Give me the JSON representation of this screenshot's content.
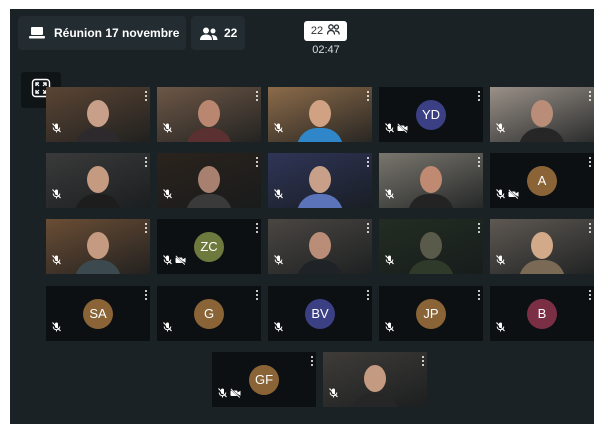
{
  "meeting": {
    "title": "Réunion 17 novembre",
    "participant_count": "22",
    "center_count": "22",
    "timer": "02:47"
  },
  "icons": {
    "title_icon": "laptop-icon",
    "participants_icon": "people-icon",
    "center_icon": "people-outline-icon",
    "expand_icon": "fullscreen-icon",
    "muted_icon": "mic-off-icon",
    "camera_off_icon": "camera-off-icon",
    "menu_icon": "more-vertical-icon"
  },
  "colors": {
    "background": "#1a2226",
    "chip": "#232c31",
    "tile": "#0d1012"
  },
  "tiles": [
    {
      "kind": "video",
      "bg": "#5b4534",
      "person": "#2c2a2c",
      "skin": "#c8a08a"
    },
    {
      "kind": "video",
      "bg": "#6d5746",
      "person": "#5a3030",
      "skin": "#b98770"
    },
    {
      "kind": "video",
      "bg": "#8c6b4a",
      "person": "#2f86c8",
      "skin": "#d0a183"
    },
    {
      "kind": "avatar",
      "initials": "YD",
      "color": "#3b3f84",
      "camera_off": true
    },
    {
      "kind": "video",
      "bg": "#9a9188",
      "person": "#262626",
      "skin": "#b98d78"
    },
    {
      "kind": "video",
      "bg": "#3a3a3a",
      "person": "#1d1d1d",
      "skin": "#c49a80"
    },
    {
      "kind": "video",
      "bg": "#2b231d",
      "person": "#3a3a3a",
      "skin": "#a88070"
    },
    {
      "kind": "video",
      "bg": "#2f3557",
      "person": "#5b73b8",
      "skin": "#c8a08a"
    },
    {
      "kind": "video",
      "bg": "#7a766e",
      "person": "#232323",
      "skin": "#c08a72"
    },
    {
      "kind": "avatar",
      "initials": "A",
      "color": "#8a6436",
      "camera_off": true
    },
    {
      "kind": "video",
      "bg": "#6a4d35",
      "person": "#3c4a50",
      "skin": "#c49a80"
    },
    {
      "kind": "avatar",
      "initials": "ZC",
      "color": "#6d7a3e",
      "camera_off": true
    },
    {
      "kind": "video",
      "bg": "#4a4642",
      "person": "#1f2328",
      "skin": "#b98d78"
    },
    {
      "kind": "video",
      "bg": "#232d22",
      "person": "#2f3a2a",
      "skin": "#5a5a4a"
    },
    {
      "kind": "video",
      "bg": "#5e5852",
      "person": "#7a6a55",
      "skin": "#d2aa8a"
    },
    {
      "kind": "avatar",
      "initials": "SA",
      "color": "#8a6436",
      "camera_off": false
    },
    {
      "kind": "avatar",
      "initials": "G",
      "color": "#8a6436",
      "camera_off": false
    },
    {
      "kind": "avatar",
      "initials": "BV",
      "color": "#3b3f84",
      "camera_off": false
    },
    {
      "kind": "avatar",
      "initials": "JP",
      "color": "#8a6436",
      "camera_off": false
    },
    {
      "kind": "avatar",
      "initials": "B",
      "color": "#7a2f45",
      "camera_off": false
    },
    {
      "kind": "avatar",
      "initials": "GF",
      "color": "#8a6436",
      "camera_off": true
    },
    {
      "kind": "video",
      "bg": "#3f3c38",
      "person": "#262626",
      "skin": "#c49a80"
    }
  ]
}
